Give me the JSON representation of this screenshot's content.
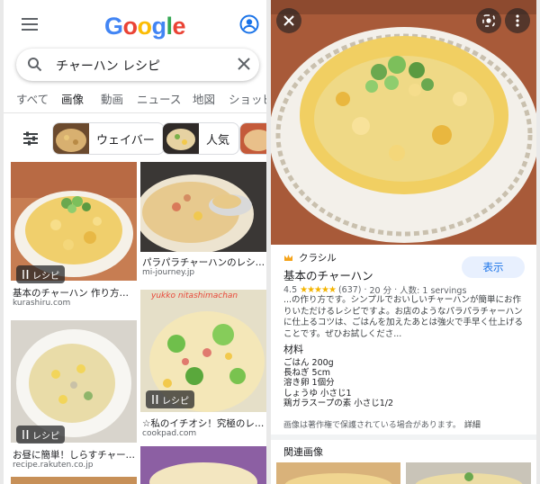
{
  "search": {
    "logo_letters": [
      "G",
      "o",
      "o",
      "g",
      "l",
      "e"
    ],
    "query": "チャーハン レシピ",
    "tabs": [
      "すべて",
      "画像",
      "動画",
      "ニュース",
      "地図",
      "ショッピ"
    ],
    "active_tab": "画像",
    "chips": [
      {
        "label": "ウェイバー"
      },
      {
        "label": "人気"
      }
    ]
  },
  "results": [
    {
      "title": "基本のチャーハン 作り方・レ...",
      "source": "kurashiru.com",
      "badge": "レシピ"
    },
    {
      "title": "パラパラチャーハンのレシピ...",
      "source": "mi-journey.jp",
      "badge": ""
    },
    {
      "title": "お昼に簡単！しらすチャーハン...",
      "source": "recipe.rakuten.co.jp",
      "badge": "レシピ"
    },
    {
      "title": "☆私のイチオシ！究極のレタ...",
      "source": "cookpad.com",
      "badge": "レシピ",
      "overlay": "yukko nitashimachan"
    }
  ],
  "detail": {
    "site": "クラシル",
    "title": "基本のチャーハン",
    "view_button": "表示",
    "rating_value": "4.5",
    "stars": "★★★★★",
    "review_count": "(637)",
    "time": "20 分",
    "servings": "人数: 1 servings",
    "description": "...の作り方です。シンプルでおいしいチャーハンが簡単にお作りいただけるレシピですよ。お店のようなパラパラチャーハンに仕上るコツは、ごはんを加えたあとは強火で手早く仕上げることです。ぜひお試しくださ...",
    "ingredients_heading": "材料",
    "ingredients": [
      "ごはん 200g",
      "長ねぎ 5cm",
      "溶き卵 1個分",
      "しょうゆ 小さじ1",
      "鶏ガラスープの素 小さじ1/2"
    ],
    "copyright_note": "画像は著作権で保護されている場合があります。",
    "more_link": "詳細",
    "related_heading": "関連画像"
  },
  "colors": {
    "google_blue": "#4285F4",
    "google_red": "#EA4335",
    "google_yellow": "#FBBC05",
    "google_green": "#34A853",
    "accent_blue": "#1a73e8",
    "star": "#f4b400"
  },
  "icons": [
    "menu-icon",
    "account-icon",
    "search-icon",
    "clear-icon",
    "filter-icon",
    "close-icon",
    "lens-icon",
    "more-icon",
    "fork-knife-icon",
    "crown-icon"
  ]
}
